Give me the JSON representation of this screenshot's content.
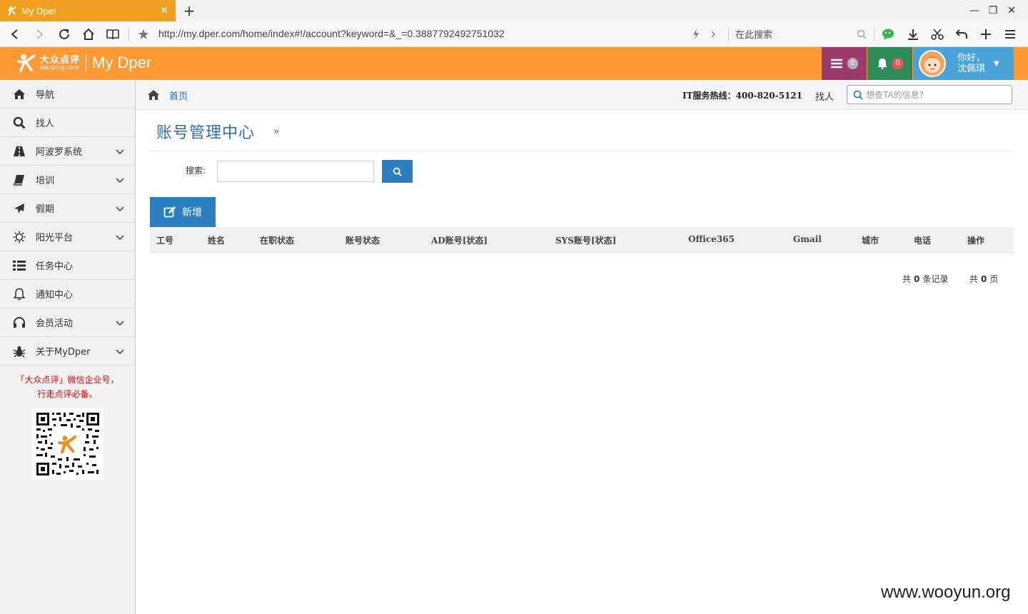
{
  "browser": {
    "tab_title": "My Dper",
    "new_tab": "+",
    "url": "http://my.dper.com/home/index#!/account?keyword=&_=0.3887792492751032",
    "search_placeholder": "在此搜索"
  },
  "header": {
    "logo_cn": "大众点评",
    "logo_en": "dianping.com",
    "app_name": "My Dper",
    "tasks_count": "0",
    "notifications_count": "0",
    "greeting_line1": "你好，",
    "greeting_line2": "沈佩琪"
  },
  "sidebar": {
    "items": [
      {
        "label": "导航",
        "icon": "home-icon"
      },
      {
        "label": "找人",
        "icon": "search-icon"
      },
      {
        "label": "阿波罗系统",
        "icon": "road-icon"
      },
      {
        "label": "培训",
        "icon": "book-icon"
      },
      {
        "label": "假期",
        "icon": "plane-icon"
      },
      {
        "label": "阳光平台",
        "icon": "sun-icon"
      },
      {
        "label": "任务中心",
        "icon": "list-icon"
      },
      {
        "label": "通知中心",
        "icon": "bell-icon"
      },
      {
        "label": "会员活动",
        "icon": "headphones-icon"
      },
      {
        "label": "关于MyDper",
        "icon": "bug-icon"
      }
    ],
    "note_line1": "「大众点评」微信企业号，",
    "note_line2": "行走点评必备。"
  },
  "breadcrumb": {
    "home": "首页",
    "hotline": "IT服务热线：400-820-5121",
    "find_people": "找人",
    "search_placeholder": "想查TA的信息?"
  },
  "main": {
    "title": "账号管理中心",
    "title_arrow": "»",
    "search_label": "搜索:",
    "add_button": "新增",
    "columns": [
      "工号",
      "姓名",
      "在职状态",
      "账号状态",
      "AD账号[状态]",
      "SYS账号[状态]",
      "Office365",
      "Gmail",
      "城市",
      "电话",
      "操作"
    ],
    "pager_total_prefix": "共",
    "pager_records": "0",
    "pager_records_suffix": "条记录",
    "pager_pages_prefix": "共",
    "pager_pages": "0",
    "pager_pages_suffix": "页"
  },
  "watermark": "www.wooyun.org",
  "colors": {
    "header_orange": "#ff9933",
    "tasks_purple": "#9b3a6b",
    "notif_green": "#2f8b5a",
    "user_blue": "#4aa3d8",
    "primary_blue": "#2a7fc0"
  }
}
